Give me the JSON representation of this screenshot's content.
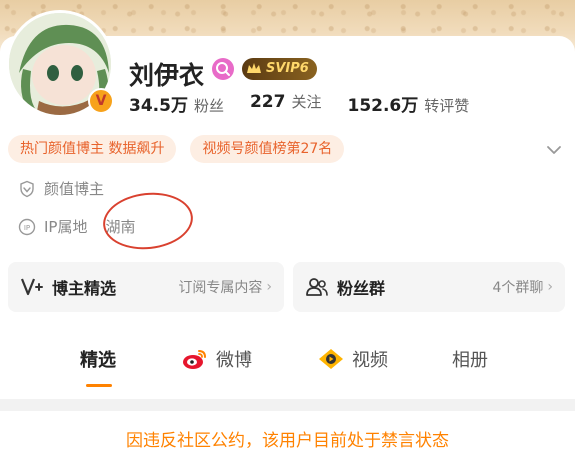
{
  "profile": {
    "name": "刘伊衣",
    "svip_label": "SVIP6",
    "stats": [
      {
        "value": "34.5万",
        "label": "粉丝"
      },
      {
        "value": "227",
        "label": "关注"
      },
      {
        "value": "152.6万",
        "label": "转评赞"
      }
    ],
    "tags": [
      "热门颜值博主 数据飙升",
      "视频号颜值榜第27名"
    ],
    "certification": "颜值博主",
    "ip_label": "IP属地",
    "ip_value": "湖南"
  },
  "cards": {
    "left": {
      "title": "博主精选",
      "sub": "订阅专属内容"
    },
    "right": {
      "title": "粉丝群",
      "sub": "4个群聊"
    }
  },
  "tabs": [
    {
      "label": "精选",
      "active": true
    },
    {
      "label": "微博",
      "active": false
    },
    {
      "label": "视频",
      "active": false
    },
    {
      "label": "相册",
      "active": false
    }
  ],
  "notice": "因违反社区公约，该用户目前处于禁言状态",
  "colors": {
    "accent": "#ff8200",
    "tag_text": "#e8632c",
    "annotation": "#d9412f"
  }
}
